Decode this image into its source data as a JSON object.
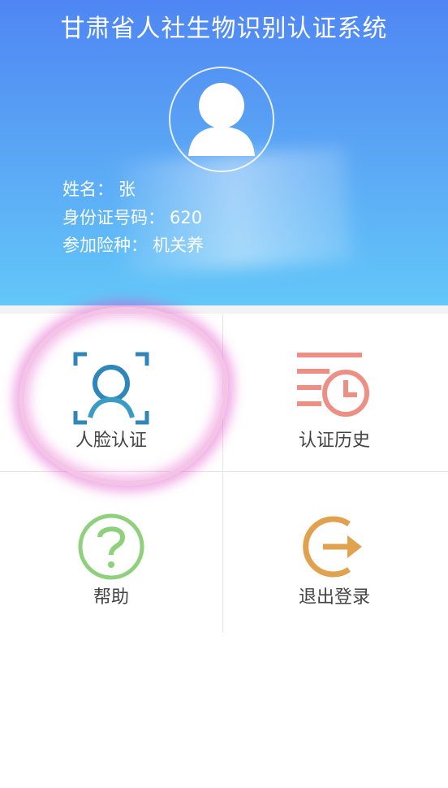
{
  "app": {
    "title": "甘肃省人社生物识别认证系统"
  },
  "profile": {
    "name_label": "姓名：",
    "name_value": "张",
    "id_label": "身份证号码：",
    "id_value": "620",
    "insurance_label": "参加险种：",
    "insurance_value": "机关养"
  },
  "menu": {
    "items": [
      {
        "label": "人脸认证",
        "icon": "face-scan-icon",
        "color": "#2f86b8"
      },
      {
        "label": "认证历史",
        "icon": "history-clock-icon",
        "color": "#ee8f86"
      },
      {
        "label": "帮助",
        "icon": "question-circle-icon",
        "color": "#8ed07c"
      },
      {
        "label": "退出登录",
        "icon": "logout-arrow-icon",
        "color": "#e0a24f"
      }
    ]
  },
  "colors": {
    "header_top": "#4f86f3",
    "header_bottom": "#63c7f8",
    "highlight": "#e146c8"
  }
}
